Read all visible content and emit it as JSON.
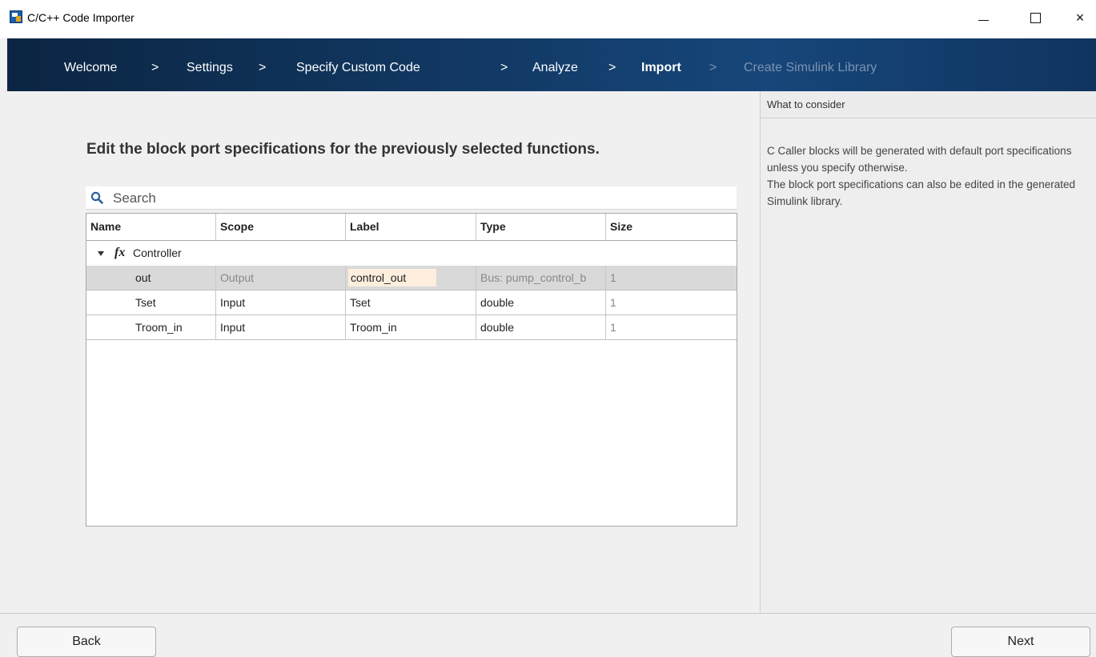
{
  "window": {
    "title": "C/C++ Code Importer",
    "icon": "matlab-app-icon",
    "controls": {
      "minimize": "minimize-icon",
      "maximize": "maximize-icon",
      "close": "×"
    }
  },
  "breadcrumb": {
    "steps": [
      {
        "label": "Welcome",
        "state": "done"
      },
      {
        "label": "Settings",
        "state": "done"
      },
      {
        "label": "Specify Custom Code",
        "state": "done"
      },
      {
        "label": "Analyze",
        "state": "done"
      },
      {
        "label": "Import",
        "state": "current"
      },
      {
        "label": "Create Simulink Library",
        "state": "pending"
      }
    ],
    "separator": ">"
  },
  "main": {
    "heading": "Edit the block port specifications for the previously selected functions.",
    "search": {
      "placeholder": "Search",
      "value": ""
    },
    "table": {
      "columns": [
        "Name",
        "Scope",
        "Label",
        "Type",
        "Size"
      ],
      "group": {
        "icon": "fx",
        "label": "Controller",
        "expanded": true
      },
      "rows": [
        {
          "name": "out",
          "scope": "Output",
          "label": "control_out",
          "type": "Bus: pump_control_b",
          "size": "1",
          "selected": true
        },
        {
          "name": "Tset",
          "scope": "Input",
          "label": "Tset",
          "type": "double",
          "size": "1",
          "selected": false
        },
        {
          "name": "Troom_in",
          "scope": "Input",
          "label": "Troom_in",
          "type": "double",
          "size": "1",
          "selected": false
        }
      ]
    }
  },
  "side": {
    "title": "What to consider",
    "lines": [
      "C Caller blocks will be generated with default port specifications unless you specify otherwise.",
      "The block port specifications can also be edited in the generated Simulink library."
    ]
  },
  "footer": {
    "back_label": "Back",
    "next_label": "Next"
  },
  "colors": {
    "banner_dark": "#0b2542",
    "banner_mid": "#16467a",
    "selected_row": "#d9d9d9",
    "edit_cell": "#fdeedd"
  }
}
